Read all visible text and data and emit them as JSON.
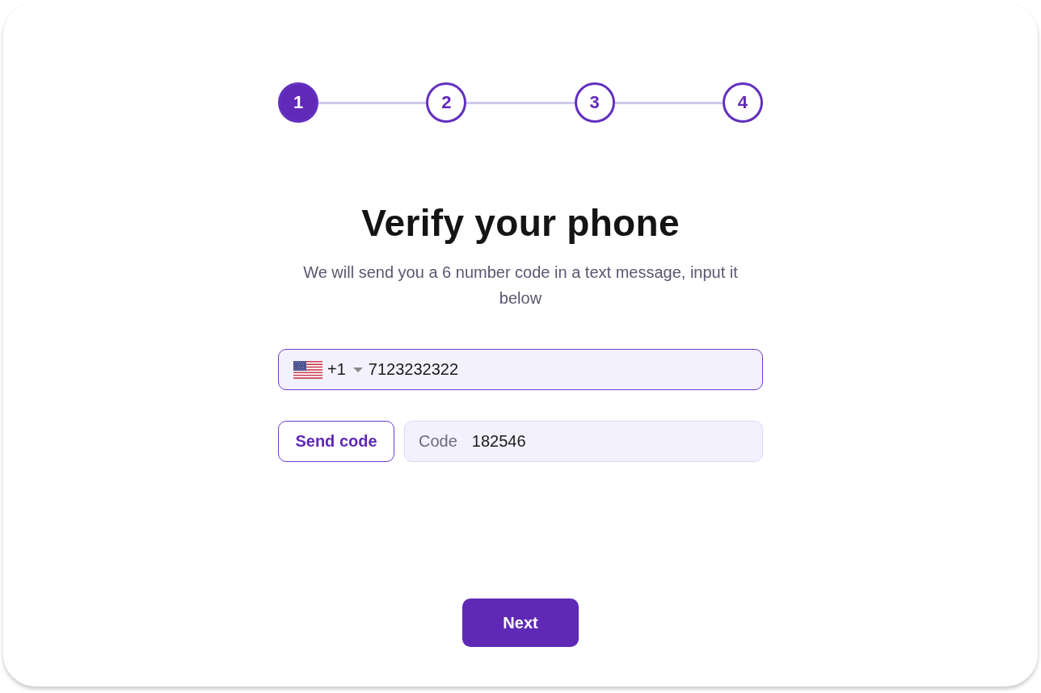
{
  "stepper": {
    "steps": [
      {
        "label": "1",
        "selected": true
      },
      {
        "label": "2",
        "selected": false
      },
      {
        "label": "3",
        "selected": false
      },
      {
        "label": "4",
        "selected": false
      }
    ]
  },
  "heading": "Verify your phone",
  "subtitle": "We will send you a 6 number code in a text message, input it below",
  "phone_field": {
    "country_code": "+1",
    "value": "7123232322",
    "focused": true
  },
  "send_code_button": "Send code",
  "code_field": {
    "label": "Code",
    "value": "182546",
    "focused": false
  },
  "next_button": "Next"
}
